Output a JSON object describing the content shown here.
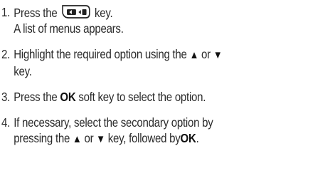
{
  "steps": [
    {
      "num": "1.",
      "press_prefix": "Press the",
      "key_suffix": "key.",
      "result": "A list of menus appears.",
      "icon": "menu-key-icon"
    },
    {
      "num": "2.",
      "text_before": "Highlight the required option using the",
      "up_symbol": "▲",
      "or_word": "or",
      "down_symbol": "▼",
      "text_after": "key."
    },
    {
      "num": "3.",
      "text_before": "Press the",
      "ok_label": "OK",
      "text_after": "soft key to select the option."
    },
    {
      "num": "4.",
      "line1": "If necessary, select the secondary option by",
      "line2_before": "pressing the",
      "up_symbol": "▲",
      "or_word": "or",
      "down_symbol": "▼",
      "line2_mid": "key, followed by",
      "ok_label": "OK",
      "period": "."
    }
  ]
}
